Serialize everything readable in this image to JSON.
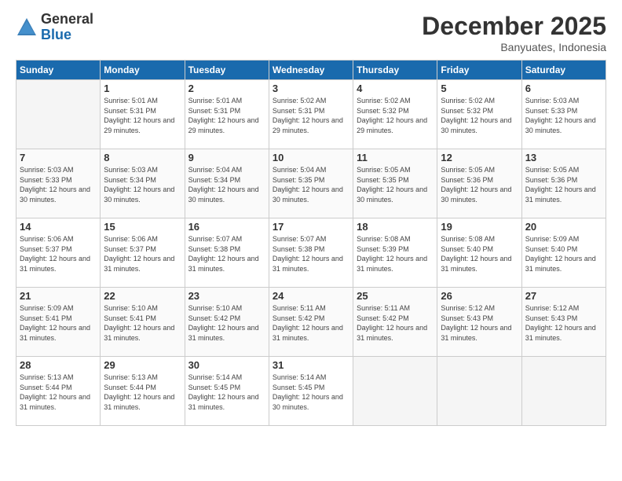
{
  "logo": {
    "general": "General",
    "blue": "Blue"
  },
  "header": {
    "title": "December 2025",
    "subtitle": "Banyuates, Indonesia"
  },
  "weekdays": [
    "Sunday",
    "Monday",
    "Tuesday",
    "Wednesday",
    "Thursday",
    "Friday",
    "Saturday"
  ],
  "weeks": [
    [
      {
        "day": "",
        "empty": true
      },
      {
        "day": "1",
        "sunrise": "5:01 AM",
        "sunset": "5:31 PM",
        "daylight": "12 hours and 29 minutes."
      },
      {
        "day": "2",
        "sunrise": "5:01 AM",
        "sunset": "5:31 PM",
        "daylight": "12 hours and 29 minutes."
      },
      {
        "day": "3",
        "sunrise": "5:02 AM",
        "sunset": "5:31 PM",
        "daylight": "12 hours and 29 minutes."
      },
      {
        "day": "4",
        "sunrise": "5:02 AM",
        "sunset": "5:32 PM",
        "daylight": "12 hours and 29 minutes."
      },
      {
        "day": "5",
        "sunrise": "5:02 AM",
        "sunset": "5:32 PM",
        "daylight": "12 hours and 30 minutes."
      },
      {
        "day": "6",
        "sunrise": "5:03 AM",
        "sunset": "5:33 PM",
        "daylight": "12 hours and 30 minutes."
      }
    ],
    [
      {
        "day": "7",
        "sunrise": "5:03 AM",
        "sunset": "5:33 PM",
        "daylight": "12 hours and 30 minutes."
      },
      {
        "day": "8",
        "sunrise": "5:03 AM",
        "sunset": "5:34 PM",
        "daylight": "12 hours and 30 minutes."
      },
      {
        "day": "9",
        "sunrise": "5:04 AM",
        "sunset": "5:34 PM",
        "daylight": "12 hours and 30 minutes."
      },
      {
        "day": "10",
        "sunrise": "5:04 AM",
        "sunset": "5:35 PM",
        "daylight": "12 hours and 30 minutes."
      },
      {
        "day": "11",
        "sunrise": "5:05 AM",
        "sunset": "5:35 PM",
        "daylight": "12 hours and 30 minutes."
      },
      {
        "day": "12",
        "sunrise": "5:05 AM",
        "sunset": "5:36 PM",
        "daylight": "12 hours and 30 minutes."
      },
      {
        "day": "13",
        "sunrise": "5:05 AM",
        "sunset": "5:36 PM",
        "daylight": "12 hours and 31 minutes."
      }
    ],
    [
      {
        "day": "14",
        "sunrise": "5:06 AM",
        "sunset": "5:37 PM",
        "daylight": "12 hours and 31 minutes."
      },
      {
        "day": "15",
        "sunrise": "5:06 AM",
        "sunset": "5:37 PM",
        "daylight": "12 hours and 31 minutes."
      },
      {
        "day": "16",
        "sunrise": "5:07 AM",
        "sunset": "5:38 PM",
        "daylight": "12 hours and 31 minutes."
      },
      {
        "day": "17",
        "sunrise": "5:07 AM",
        "sunset": "5:38 PM",
        "daylight": "12 hours and 31 minutes."
      },
      {
        "day": "18",
        "sunrise": "5:08 AM",
        "sunset": "5:39 PM",
        "daylight": "12 hours and 31 minutes."
      },
      {
        "day": "19",
        "sunrise": "5:08 AM",
        "sunset": "5:40 PM",
        "daylight": "12 hours and 31 minutes."
      },
      {
        "day": "20",
        "sunrise": "5:09 AM",
        "sunset": "5:40 PM",
        "daylight": "12 hours and 31 minutes."
      }
    ],
    [
      {
        "day": "21",
        "sunrise": "5:09 AM",
        "sunset": "5:41 PM",
        "daylight": "12 hours and 31 minutes."
      },
      {
        "day": "22",
        "sunrise": "5:10 AM",
        "sunset": "5:41 PM",
        "daylight": "12 hours and 31 minutes."
      },
      {
        "day": "23",
        "sunrise": "5:10 AM",
        "sunset": "5:42 PM",
        "daylight": "12 hours and 31 minutes."
      },
      {
        "day": "24",
        "sunrise": "5:11 AM",
        "sunset": "5:42 PM",
        "daylight": "12 hours and 31 minutes."
      },
      {
        "day": "25",
        "sunrise": "5:11 AM",
        "sunset": "5:42 PM",
        "daylight": "12 hours and 31 minutes."
      },
      {
        "day": "26",
        "sunrise": "5:12 AM",
        "sunset": "5:43 PM",
        "daylight": "12 hours and 31 minutes."
      },
      {
        "day": "27",
        "sunrise": "5:12 AM",
        "sunset": "5:43 PM",
        "daylight": "12 hours and 31 minutes."
      }
    ],
    [
      {
        "day": "28",
        "sunrise": "5:13 AM",
        "sunset": "5:44 PM",
        "daylight": "12 hours and 31 minutes."
      },
      {
        "day": "29",
        "sunrise": "5:13 AM",
        "sunset": "5:44 PM",
        "daylight": "12 hours and 31 minutes."
      },
      {
        "day": "30",
        "sunrise": "5:14 AM",
        "sunset": "5:45 PM",
        "daylight": "12 hours and 31 minutes."
      },
      {
        "day": "31",
        "sunrise": "5:14 AM",
        "sunset": "5:45 PM",
        "daylight": "12 hours and 30 minutes."
      },
      {
        "day": "",
        "empty": true
      },
      {
        "day": "",
        "empty": true
      },
      {
        "day": "",
        "empty": true
      }
    ]
  ]
}
